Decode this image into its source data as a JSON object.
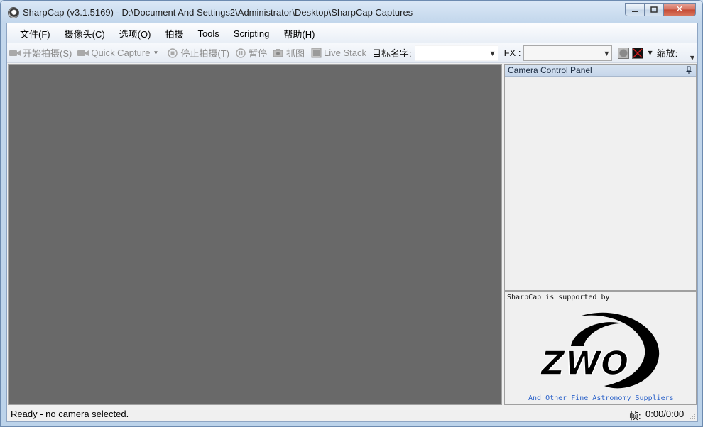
{
  "window": {
    "title": "SharpCap (v3.1.5169) - D:\\Document And Settings2\\Administrator\\Desktop\\SharpCap Captures"
  },
  "menu": [
    "文件(F)",
    "摄像头(C)",
    "选项(O)",
    "拍摄",
    "Tools",
    "Scripting",
    "帮助(H)"
  ],
  "toolbar": {
    "start_capture": "开始拍摄(S)",
    "quick_capture": "Quick Capture",
    "stop_capture": "停止拍摄(T)",
    "pause": "暂停",
    "snapshot": "抓图",
    "live_stack": "Live Stack",
    "target_name_label": "目标名字:",
    "target_name_value": "",
    "fx_label": "FX :",
    "fx_value": "",
    "zoom_label": "缩放:"
  },
  "panel": {
    "header": "Camera Control Panel"
  },
  "sponsor": {
    "text": "SharpCap is supported by",
    "logo_text": "ZWO",
    "link": "And Other Fine Astronomy Suppliers"
  },
  "status": {
    "text": "Ready - no camera selected.",
    "frame_label": "帧:",
    "frame_value": "0:00/0:00"
  },
  "colors": {
    "preview_bg": "#696969",
    "link": "#2b62c9",
    "titlebar": "#c3d7ec"
  }
}
